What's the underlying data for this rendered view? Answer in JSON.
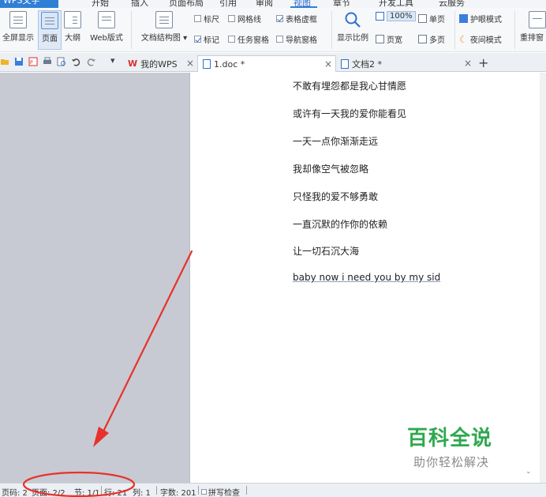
{
  "menubar": {
    "brand": "WPS文字",
    "items": [
      "开始",
      "插入",
      "页面布局",
      "引用",
      "审阅",
      "视图",
      "章节",
      "开发工具",
      "云服务"
    ],
    "active": "视图"
  },
  "ribbon": {
    "fullscreen": "全屏显示",
    "page": "页面",
    "outline": "大纲",
    "web": "Web版式",
    "docmap": "文档结构图",
    "ruler": "标尺",
    "gridlines": "网格线",
    "table_gridlines": "表格虚框",
    "marks": "标记",
    "task_pane": "任务窗格",
    "nav_pane": "导航窗格",
    "zoom": "显示比例",
    "zoom_value": "100%",
    "page_width": "页宽",
    "single_page": "单页",
    "multi_page": "多页",
    "eye_mode": "护眼模式",
    "night_mode": "夜间模式",
    "rearrange": "重排窗"
  },
  "tabs": {
    "mywps": "我的WPS",
    "doc1": "1.doc *",
    "doc2": "文档2 *",
    "close": "×",
    "new": "+"
  },
  "document": {
    "lines": [
      "不敢有埋怨都是我心甘情愿",
      "或许有一天我的爱你能看见",
      "一天一点你渐渐走远",
      "我却像空气被忽略",
      "只怪我的爱不够勇敢",
      "一直沉默的作你的依赖",
      "让一切石沉大海",
      "baby now i need you by my sid"
    ]
  },
  "watermark": {
    "title": "百科全说",
    "subtitle": "助你轻松解决"
  },
  "status": {
    "page_no": "页码: 2",
    "pages": "页面: 2/2",
    "section": "节: 1/1",
    "row": "行: 21",
    "col": "列: 1",
    "word_count": "字数: 201",
    "spell": "拼写检查"
  },
  "colors": {
    "accent": "#2f7fd6",
    "annotation": "#e8312b",
    "watermark_green": "#2fa84f"
  }
}
